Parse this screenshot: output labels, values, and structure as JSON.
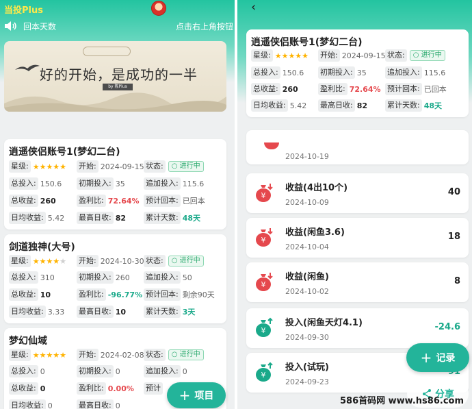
{
  "left": {
    "app_title": "当投Plus",
    "notice_left": "回本天数",
    "notice_right": "点击右上角按钮",
    "banner": {
      "stamp": "",
      "text": "好的开始，是成功的一半",
      "sub": "by 陈Plus"
    },
    "labels": {
      "rating": "星级:",
      "start": "开始:",
      "status": "状态:",
      "total_invest": "总投入:",
      "initial_invest": "初期投入:",
      "add_invest": "追加投入:",
      "total_income": "总收益:",
      "profit_ratio": "盈利比:",
      "expected_return": "预计回本:",
      "daily_income": "日均收益:",
      "max_daily": "最高日收:",
      "total_days": "累计天数:"
    },
    "cards": [
      {
        "title": "逍遥侠侣账号1(梦幻二台)",
        "stars": 5,
        "start": "2024-09-15",
        "status": "进行中",
        "total_invest": "150.6",
        "initial_invest": "35",
        "add_invest": "115.6",
        "total_income": "260",
        "profit_ratio": "72.64%",
        "expected_return": "已回本",
        "daily_income": "5.42",
        "max_daily": "82",
        "total_days": "48天"
      },
      {
        "title": "剑道独神(大号)",
        "stars": 4,
        "start": "2024-10-30",
        "status": "进行中",
        "total_invest": "310",
        "initial_invest": "260",
        "add_invest": "50",
        "total_income": "10",
        "profit_ratio": "-96.77%",
        "expected_return": "剩余90天",
        "daily_income": "3.33",
        "max_daily": "10",
        "total_days": "3天"
      },
      {
        "title": "梦幻仙域",
        "stars": 5,
        "start": "2024-02-08",
        "status": "进行中",
        "total_invest": "0",
        "initial_invest": "0",
        "add_invest": "0",
        "total_income": "0",
        "profit_ratio": "0.00%",
        "expected_return": "预计",
        "daily_income": "0",
        "max_daily": "0",
        "total_days": ""
      }
    ],
    "fab_label": "项目"
  },
  "right": {
    "back_icon": "‹",
    "card": {
      "title": "逍遥侠侣账号1(梦幻二台)",
      "stars": 5,
      "start": "2024-09-15",
      "status": "进行中",
      "total_invest": "150.6",
      "initial_invest": "35",
      "add_invest": "115.6",
      "total_income": "260",
      "profit_ratio": "72.64%",
      "expected_return": "已回本",
      "daily_income": "5.42",
      "max_daily": "82",
      "total_days": "48天"
    },
    "partial_date": "2024-10-19",
    "records": [
      {
        "title": "收益(4出10个)",
        "date": "2024-10-09",
        "amount": "40",
        "kind": "income"
      },
      {
        "title": "收益(闲鱼3.6)",
        "date": "2024-10-04",
        "amount": "18",
        "kind": "income"
      },
      {
        "title": "收益(闲鱼)",
        "date": "2024-10-02",
        "amount": "8",
        "kind": "income"
      },
      {
        "title": "投入(闲鱼天灯4.1)",
        "date": "2024-09-30",
        "amount": "-24.6",
        "kind": "invest"
      },
      {
        "title": "投入(试玩)",
        "date": "2024-09-23",
        "amount": "-91",
        "kind": "invest"
      }
    ],
    "fab_label": "记录",
    "share_label": "分享"
  },
  "watermark": "586首码网 www.hs86.com",
  "colors": {
    "accent": "#23b49a",
    "income_icon": "#e5484d",
    "invest_icon": "#1aa98a",
    "star": "#ffb300"
  }
}
